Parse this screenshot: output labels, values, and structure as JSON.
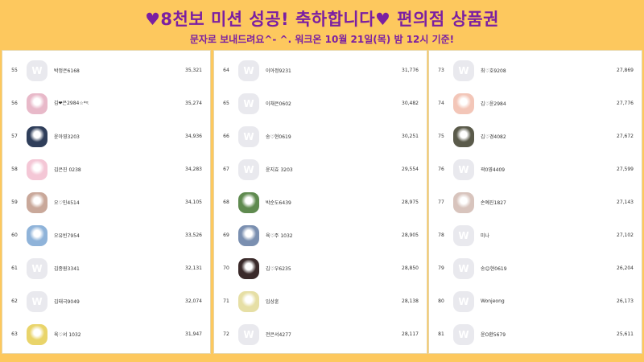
{
  "header": {
    "title": "♥8천보 미션 성공! 축하합니다♥ 편의점 상품권",
    "subtitle": "문자로 보내드려요^- ^. 워크온 10월 21일(목) 밤 12시 기준!"
  },
  "columns": [
    {
      "rows": [
        {
          "rank": "55",
          "name": "박정은6168",
          "score": "35,321",
          "avatar": "W",
          "photo": false,
          "color": "#e9e9ee"
        },
        {
          "rank": "56",
          "name": "김❤은2984☆*ৎ",
          "score": "35,274",
          "avatar": "",
          "photo": true,
          "color": "#e8b9c9"
        },
        {
          "rank": "57",
          "name": "윤아영3203",
          "score": "34,936",
          "avatar": "",
          "photo": true,
          "color": "#2f3e5a"
        },
        {
          "rank": "58",
          "name": "김은진 0238",
          "score": "34,283",
          "avatar": "",
          "photo": true,
          "color": "#f4c7d6"
        },
        {
          "rank": "59",
          "name": "오♡민4514",
          "score": "34,105",
          "avatar": "",
          "photo": true,
          "color": "#c9a89a"
        },
        {
          "rank": "60",
          "name": "오유빈7954",
          "score": "33,526",
          "avatar": "",
          "photo": true,
          "color": "#8fb3d9"
        },
        {
          "rank": "61",
          "name": "김종원3341",
          "score": "32,131",
          "avatar": "W",
          "photo": false,
          "color": "#e9e9ee"
        },
        {
          "rank": "62",
          "name": "김태극9049",
          "score": "32,074",
          "avatar": "W",
          "photo": false,
          "color": "#e9e9ee"
        },
        {
          "rank": "63",
          "name": "육♡서 1032",
          "score": "31,947",
          "avatar": "",
          "photo": true,
          "color": "#e9d46a"
        }
      ]
    },
    {
      "rows": [
        {
          "rank": "64",
          "name": "이아정9231",
          "score": "31,776",
          "avatar": "W",
          "photo": false,
          "color": "#e9e9ee"
        },
        {
          "rank": "65",
          "name": "이채은0602",
          "score": "30,482",
          "avatar": "W",
          "photo": false,
          "color": "#e9e9ee"
        },
        {
          "rank": "66",
          "name": "송♡현0619",
          "score": "30,251",
          "avatar": "W",
          "photo": false,
          "color": "#e9e9ee"
        },
        {
          "rank": "67",
          "name": "윤지효 3203",
          "score": "29,554",
          "avatar": "W",
          "photo": false,
          "color": "#e9e9ee"
        },
        {
          "rank": "68",
          "name": "박순도6439",
          "score": "28,975",
          "avatar": "",
          "photo": true,
          "color": "#5f8a4f"
        },
        {
          "rank": "69",
          "name": "육♡주 1032",
          "score": "28,905",
          "avatar": "",
          "photo": true,
          "color": "#7a8fb0"
        },
        {
          "rank": "70",
          "name": "김♡우6235",
          "score": "28,850",
          "avatar": "",
          "photo": true,
          "color": "#3a2a2a"
        },
        {
          "rank": "71",
          "name": "임상훈",
          "score": "28,138",
          "avatar": "",
          "photo": true,
          "color": "#e6dfa5"
        },
        {
          "rank": "72",
          "name": "전은서4277",
          "score": "28,117",
          "avatar": "W",
          "photo": false,
          "color": "#e9e9ee"
        }
      ]
    },
    {
      "rows": [
        {
          "rank": "73",
          "name": "최♡호9208",
          "score": "27,869",
          "avatar": "W",
          "photo": false,
          "color": "#e9e9ee"
        },
        {
          "rank": "74",
          "name": "김♡윤2984",
          "score": "27,776",
          "avatar": "",
          "photo": true,
          "color": "#f3c6b8"
        },
        {
          "rank": "75",
          "name": "김♡경4082",
          "score": "27,672",
          "avatar": "",
          "photo": true,
          "color": "#5a5a4a"
        },
        {
          "rank": "76",
          "name": "곽0영4409",
          "score": "27,599",
          "avatar": "W",
          "photo": false,
          "color": "#e9e9ee"
        },
        {
          "rank": "77",
          "name": "손예진1827",
          "score": "27,143",
          "avatar": "",
          "photo": true,
          "color": "#d8c4bd"
        },
        {
          "rank": "78",
          "name": "미나",
          "score": "27,102",
          "avatar": "W",
          "photo": false,
          "color": "#e9e9ee"
        },
        {
          "rank": "79",
          "name": "송😊현0619",
          "score": "26,204",
          "avatar": "W",
          "photo": false,
          "color": "#e9e9ee"
        },
        {
          "rank": "80",
          "name": "Wonjeong",
          "score": "26,173",
          "avatar": "W",
          "photo": false,
          "color": "#e9e9ee"
        },
        {
          "rank": "81",
          "name": "윤O환5679",
          "score": "25,611",
          "avatar": "W",
          "photo": false,
          "color": "#e9e9ee"
        }
      ]
    }
  ]
}
